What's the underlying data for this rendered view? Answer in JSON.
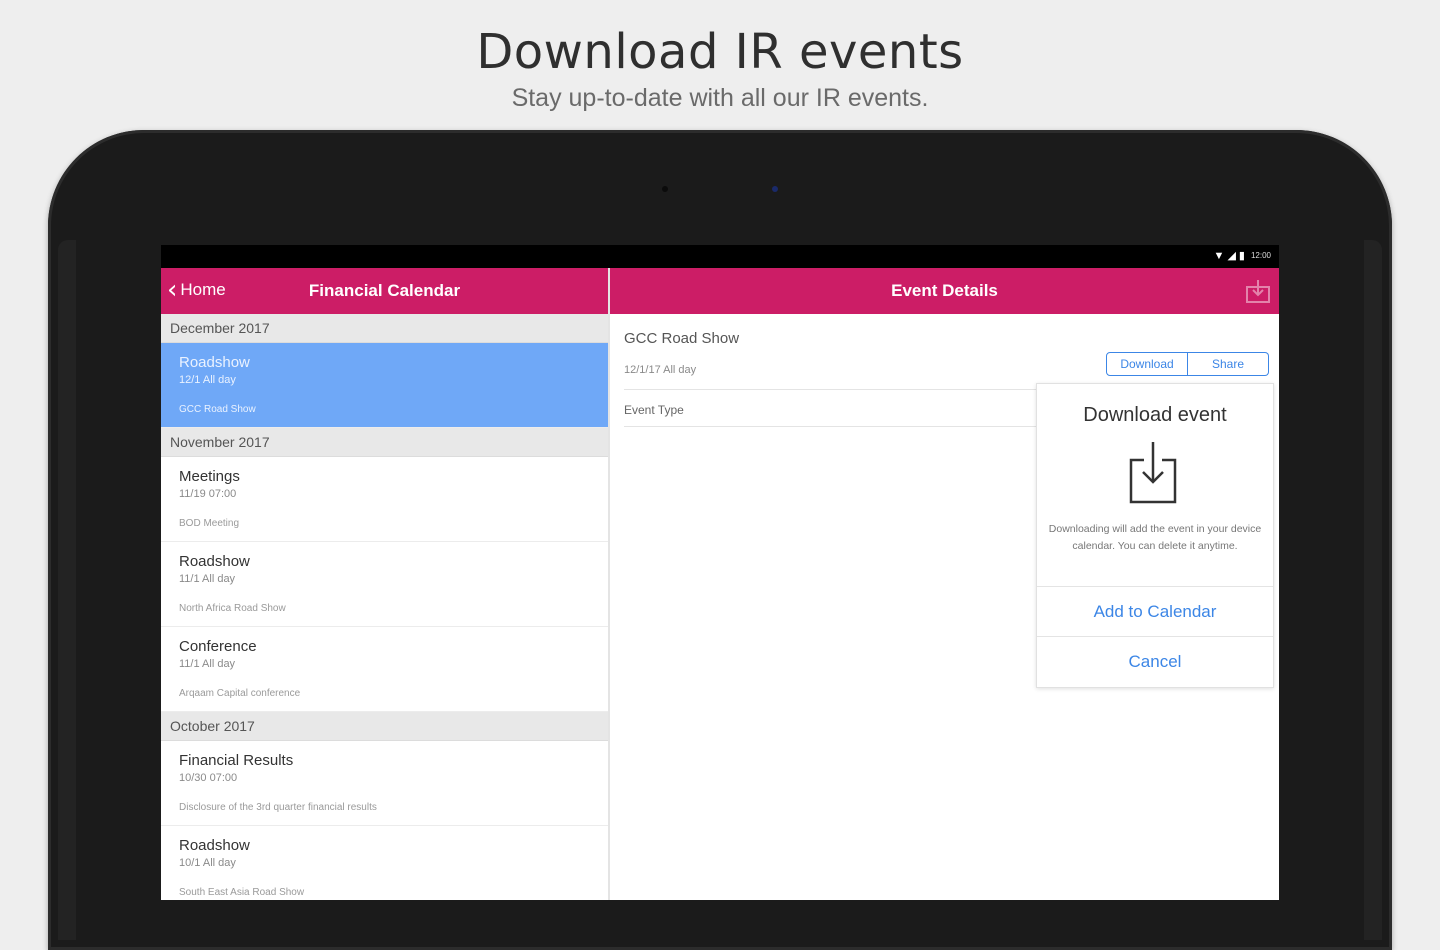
{
  "promo": {
    "title": "Download IR events",
    "subtitle": "Stay up-to-date with all our IR events."
  },
  "status_bar": {
    "icons": [
      "wifi-icon",
      "signal-icon",
      "battery-icon"
    ],
    "time": "12:00"
  },
  "left_pane": {
    "back_label": "Home",
    "title": "Financial Calendar",
    "sections": [
      {
        "header": "December 2017",
        "events": [
          {
            "title": "Roadshow",
            "time": "12/1 All day",
            "desc": "GCC Road Show",
            "selected": true
          }
        ]
      },
      {
        "header": "November 2017",
        "events": [
          {
            "title": "Meetings",
            "time": "11/19 07:00",
            "desc": "BOD Meeting"
          },
          {
            "title": "Roadshow",
            "time": "11/1 All day",
            "desc": "North Africa Road Show"
          },
          {
            "title": "Conference",
            "time": "11/1 All day",
            "desc": "Arqaam Capital conference"
          }
        ]
      },
      {
        "header": "October 2017",
        "events": [
          {
            "title": "Financial Results",
            "time": "10/30 07:00",
            "desc": "Disclosure of the 3rd quarter financial results"
          },
          {
            "title": "Roadshow",
            "time": "10/1 All day",
            "desc": "South East Asia Road Show"
          }
        ]
      }
    ]
  },
  "right_pane": {
    "title": "Event Details",
    "event_title": "GCC Road Show",
    "event_date": "12/1/17 All day",
    "event_type_label": "Event Type",
    "download_button": "Download",
    "share_button": "Share"
  },
  "popover": {
    "title": "Download event",
    "text": "Downloading will add the event in your device calendar. You can delete it anytime.",
    "add_label": "Add to Calendar",
    "cancel_label": "Cancel"
  },
  "colors": {
    "navbar": "#cc1d66",
    "selected_row": "#6fa8f7",
    "link_blue": "#3c86e6"
  }
}
